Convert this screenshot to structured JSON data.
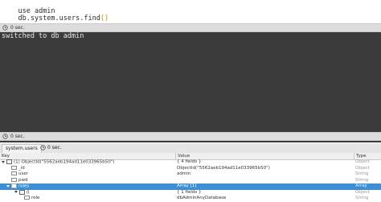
{
  "editor": {
    "lines": [
      "use admin",
      "db.system.users.find",
      "()"
    ]
  },
  "status1": {
    "time": "0 sec."
  },
  "output": {
    "line": "switched to db admin"
  },
  "status2": {
    "time": "0 sec."
  },
  "results_tab": {
    "label": "system.users",
    "time": "0 sec."
  },
  "grid": {
    "headers": {
      "key": "Key",
      "value": "Value",
      "type": "Type"
    },
    "rows": [
      {
        "key": "(1) ObjectId(\"5562aeb194ad11e033965b50\")",
        "value": "{ 4 fields }",
        "type": "Object"
      },
      {
        "key": "_id",
        "value": "ObjectId(\"5562aeb194ad11e033965b50\")",
        "type": "Object"
      },
      {
        "key": "user",
        "value": "admin",
        "type": "String"
      },
      {
        "key": "pwd",
        "value": "",
        "type": "String"
      },
      {
        "key": "roles",
        "value": "Array [1]",
        "type": "Array"
      },
      {
        "key": "0",
        "value": "{ 1 fields }",
        "type": "Object"
      },
      {
        "key": "role",
        "value": "dbAdminAnyDatabase",
        "type": "String"
      }
    ]
  }
}
